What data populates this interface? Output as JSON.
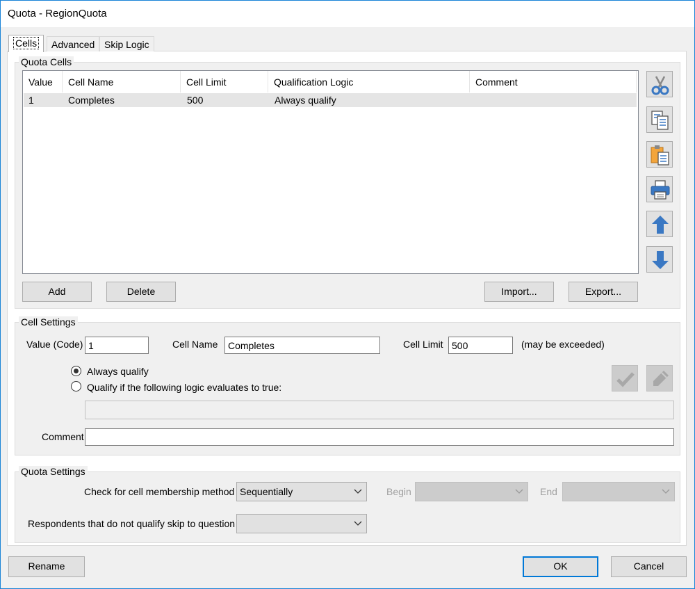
{
  "window": {
    "title": "Quota - RegionQuota"
  },
  "tabs": [
    {
      "label": "Cells"
    },
    {
      "label": "Advanced"
    },
    {
      "label": "Skip Logic"
    }
  ],
  "quota_cells": {
    "legend": "Quota Cells",
    "columns": [
      "Value",
      "Cell Name",
      "Cell Limit",
      "Qualification Logic",
      "Comment"
    ],
    "rows": [
      {
        "value": "1",
        "cell_name": "Completes",
        "cell_limit": "500",
        "qualification": "Always qualify",
        "comment": ""
      }
    ],
    "add_label": "Add",
    "delete_label": "Delete",
    "import_label": "Import...",
    "export_label": "Export..."
  },
  "toolbar_icons": [
    "cut-icon",
    "copy-icon",
    "paste-icon",
    "print-icon",
    "move-up-icon",
    "move-down-icon"
  ],
  "cell_settings": {
    "legend": "Cell Settings",
    "value_label": "Value (Code)",
    "value": "1",
    "cell_name_label": "Cell Name",
    "cell_name": "Completes",
    "cell_limit_label": "Cell Limit",
    "cell_limit": "500",
    "exceed_note": "(may be exceeded)",
    "always_qualify_label": "Always qualify",
    "logic_label": "Qualify if the following logic evaluates to true:",
    "logic_value": "",
    "comment_label": "Comment",
    "comment_value": ""
  },
  "quota_settings": {
    "legend": "Quota Settings",
    "method_label": "Check for cell membership method",
    "method_value": "Sequentially",
    "begin_label": "Begin",
    "begin_value": "",
    "end_label": "End",
    "end_value": "",
    "skip_label": "Respondents that do not qualify skip to question",
    "skip_value": ""
  },
  "footer": {
    "rename_label": "Rename",
    "ok_label": "OK",
    "cancel_label": "Cancel"
  },
  "colors": {
    "accent": "#0078d7",
    "icon_blue": "#3a78c3",
    "icon_orange": "#f3a53b"
  }
}
